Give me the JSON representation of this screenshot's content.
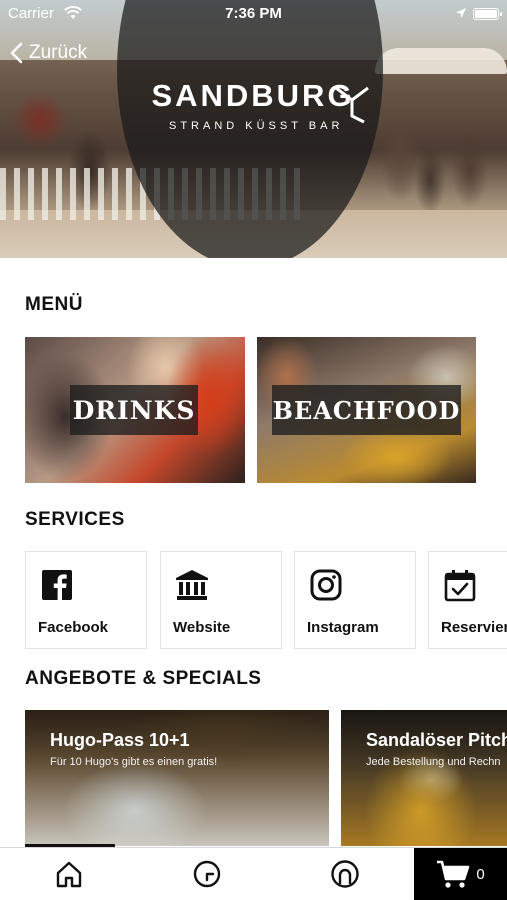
{
  "status_bar": {
    "carrier": "Carrier",
    "time": "7:36 PM",
    "icons": [
      "wifi-icon",
      "location-icon",
      "battery-icon"
    ]
  },
  "nav": {
    "back_label": "Zurück"
  },
  "hero": {
    "logo_title": "SANDBURG",
    "logo_subtitle": "STRAND KÜSST BAR"
  },
  "menu": {
    "title": "MENÜ",
    "tiles": [
      {
        "label": "DRINKS"
      },
      {
        "label": "BEACHFOOD"
      }
    ]
  },
  "services": {
    "title": "SERVICES",
    "items": [
      {
        "label": "Facebook",
        "icon": "facebook-icon"
      },
      {
        "label": "Website",
        "icon": "bank-icon"
      },
      {
        "label": "Instagram",
        "icon": "instagram-icon"
      },
      {
        "label": "Reservieru",
        "icon": "calendar-check-icon"
      }
    ]
  },
  "offers": {
    "title": "ANGEBOTE & SPECIALS",
    "items": [
      {
        "title": "Hugo-Pass 10+1",
        "subtitle": "Für 10 Hugo's gibt es einen gratis!"
      },
      {
        "title": "Sandalöser Pitcher",
        "subtitle": "Jede Bestellung und Rechn"
      }
    ]
  },
  "tab_bar": {
    "tabs": [
      {
        "icon": "home-icon",
        "active": true
      },
      {
        "icon": "clock-icon"
      },
      {
        "icon": "profile-icon"
      },
      {
        "icon": "cart-icon"
      }
    ],
    "cart_count": "0"
  },
  "colors": {
    "text": "#111111",
    "tab_cart_bg": "#000000",
    "card_border": "#e3e3e3"
  }
}
